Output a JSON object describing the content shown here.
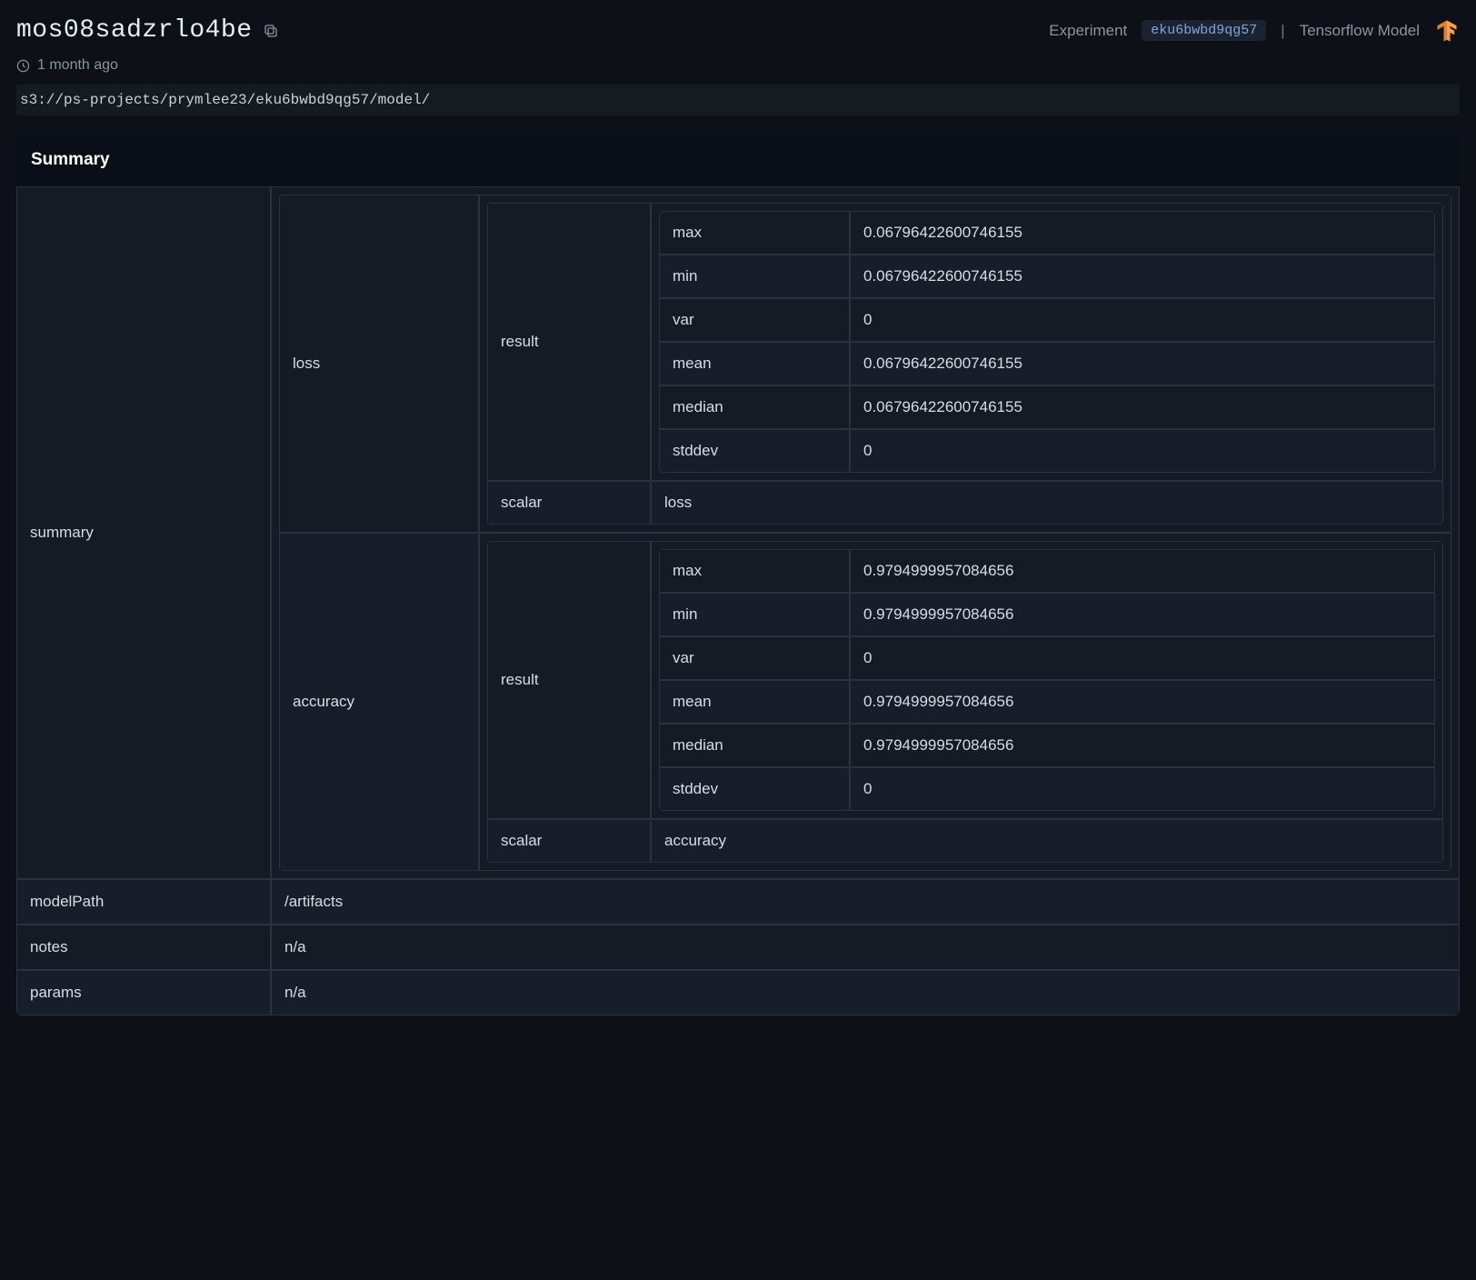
{
  "header": {
    "title": "mos08sadzrlo4be",
    "experiment_label": "Experiment",
    "experiment_id": "eku6bwbd9qg57",
    "model_type_label": "Tensorflow Model",
    "timestamp": "1 month ago",
    "storage_path": "s3://ps-projects/prymlee23/eku6bwbd9qg57/model/"
  },
  "card": {
    "title": "Summary"
  },
  "rows": {
    "summary_label": "summary",
    "modelpath_label": "modelPath",
    "modelpath_value": "/artifacts",
    "notes_label": "notes",
    "notes_value": "n/a",
    "params_label": "params",
    "params_value": "n/a"
  },
  "metrics": [
    {
      "name": "loss",
      "result_label": "result",
      "scalar_label": "scalar",
      "scalar_value": "loss",
      "stats": {
        "max": {
          "label": "max",
          "value": "0.06796422600746155"
        },
        "min": {
          "label": "min",
          "value": "0.06796422600746155"
        },
        "var": {
          "label": "var",
          "value": "0"
        },
        "mean": {
          "label": "mean",
          "value": "0.06796422600746155"
        },
        "median": {
          "label": "median",
          "value": "0.06796422600746155"
        },
        "stddev": {
          "label": "stddev",
          "value": "0"
        }
      }
    },
    {
      "name": "accuracy",
      "result_label": "result",
      "scalar_label": "scalar",
      "scalar_value": "accuracy",
      "stats": {
        "max": {
          "label": "max",
          "value": "0.9794999957084656"
        },
        "min": {
          "label": "min",
          "value": "0.9794999957084656"
        },
        "var": {
          "label": "var",
          "value": "0"
        },
        "mean": {
          "label": "mean",
          "value": "0.9794999957084656"
        },
        "median": {
          "label": "median",
          "value": "0.9794999957084656"
        },
        "stddev": {
          "label": "stddev",
          "value": "0"
        }
      }
    }
  ]
}
